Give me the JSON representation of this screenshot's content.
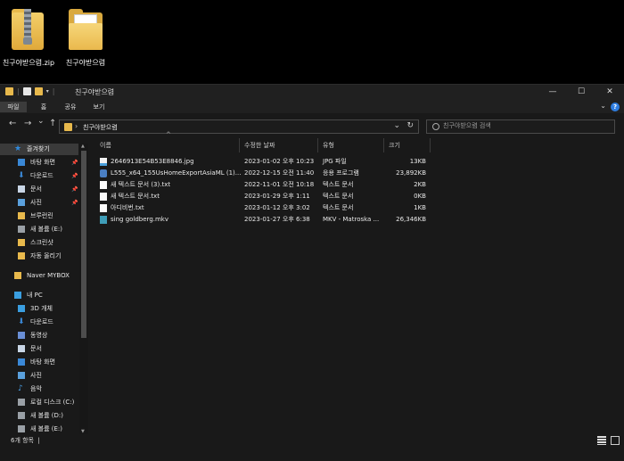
{
  "desktop": [
    {
      "label": "친구야받으렴.zip",
      "icon": "zip-folder-icon"
    },
    {
      "label": "친구야받으렴",
      "icon": "folder-icon"
    }
  ],
  "window": {
    "title": "친구야받으렴",
    "controls": {
      "minimize": "—",
      "maximize": "☐",
      "close": "✕"
    }
  },
  "ribbon": {
    "tabs": [
      "파일",
      "홈",
      "공유",
      "보기"
    ],
    "active": "파일",
    "help": "?"
  },
  "nav": {
    "back": "←",
    "forward": "→",
    "recent": "⌄",
    "up": "↑"
  },
  "address": {
    "path": "친구야받으렴",
    "sep": "›"
  },
  "search": {
    "placeholder": "친구야받으렴 검색"
  },
  "sidebar": [
    {
      "label": "즐겨찾기",
      "icon": "star-icon",
      "color": "#2f8ce0",
      "indent": 0,
      "selected": true,
      "pinned": false
    },
    {
      "label": "바탕 화면",
      "icon": "desktop-icon",
      "color": "#3a88d6",
      "indent": 1,
      "pinned": true
    },
    {
      "label": "다운로드",
      "icon": "download-icon",
      "color": "#3a88d6",
      "indent": 1,
      "pinned": true
    },
    {
      "label": "문서",
      "icon": "document-icon",
      "color": "#c9d6e6",
      "indent": 1,
      "pinned": true
    },
    {
      "label": "사진",
      "icon": "picture-icon",
      "color": "#5aa0dc",
      "indent": 1,
      "pinned": true
    },
    {
      "label": "브루런린",
      "icon": "folder-icon",
      "color": "#e8b94c",
      "indent": 1
    },
    {
      "label": "새 볼륨 (E:)",
      "icon": "drive-icon",
      "color": "#9aa0a6",
      "indent": 1
    },
    {
      "label": "스크린샷",
      "icon": "folder-icon",
      "color": "#e8b94c",
      "indent": 1
    },
    {
      "label": "자동 올리기",
      "icon": "folder-icon",
      "color": "#e8b94c",
      "indent": 1
    },
    {
      "label": "Naver MYBOX",
      "icon": "cloud-folder-icon",
      "color": "#e8b94c",
      "indent": 0,
      "gap": true
    },
    {
      "label": "내 PC",
      "icon": "computer-icon",
      "color": "#3a9ee0",
      "indent": 0,
      "gap": true
    },
    {
      "label": "3D 개체",
      "icon": "cube-icon",
      "color": "#3a9ee0",
      "indent": 1
    },
    {
      "label": "다운로드",
      "icon": "download-icon",
      "color": "#3a88d6",
      "indent": 1
    },
    {
      "label": "동영상",
      "icon": "video-icon",
      "color": "#6a8fd6",
      "indent": 1
    },
    {
      "label": "문서",
      "icon": "document-icon",
      "color": "#c9d6e6",
      "indent": 1
    },
    {
      "label": "바탕 화면",
      "icon": "desktop-icon",
      "color": "#3a88d6",
      "indent": 1
    },
    {
      "label": "사진",
      "icon": "picture-icon",
      "color": "#5aa0dc",
      "indent": 1
    },
    {
      "label": "음악",
      "icon": "music-icon",
      "color": "#4aa0e6",
      "indent": 1
    },
    {
      "label": "로컬 디스크 (C:)",
      "icon": "drive-icon",
      "color": "#9aa0a6",
      "indent": 1
    },
    {
      "label": "새 볼륨 (D:)",
      "icon": "drive-icon",
      "color": "#9aa0a6",
      "indent": 1
    },
    {
      "label": "새 볼륨 (E:)",
      "icon": "drive-icon",
      "color": "#9aa0a6",
      "indent": 1
    }
  ],
  "columns": [
    "이름",
    "수정한 날짜",
    "유형",
    "크기"
  ],
  "files": [
    {
      "name": "2646913E54B53E8846.jpg",
      "date": "2023-01-02 오후 10:23",
      "type": "JPG 파일",
      "size": "13KB",
      "icon": "image-file-icon"
    },
    {
      "name": "L555_x64_155UsHomeExportAsiaML (1)...",
      "date": "2022-12-15 오전 11:40",
      "type": "응용 프로그램",
      "size": "23,892KB",
      "icon": "app-icon"
    },
    {
      "name": "새 텍스트 문서 (3).txt",
      "date": "2022-11-01 오전 10:18",
      "type": "텍스트 문서",
      "size": "2KB",
      "icon": "text-file-icon"
    },
    {
      "name": "새 텍스트 문서.txt",
      "date": "2023-01-29 오후 1:11",
      "type": "텍스트 문서",
      "size": "0KB",
      "icon": "text-file-icon"
    },
    {
      "name": "아디비번.txt",
      "date": "2023-01-12 오후 3:02",
      "type": "텍스트 문서",
      "size": "1KB",
      "icon": "text-file-icon"
    },
    {
      "name": "sing goldberg.mkv",
      "date": "2023-01-27 오후 6:38",
      "type": "MKV - Matroska ...",
      "size": "26,346KB",
      "icon": "video-file-icon"
    }
  ],
  "status": {
    "count": "6개 항목",
    "cursor": "|"
  }
}
